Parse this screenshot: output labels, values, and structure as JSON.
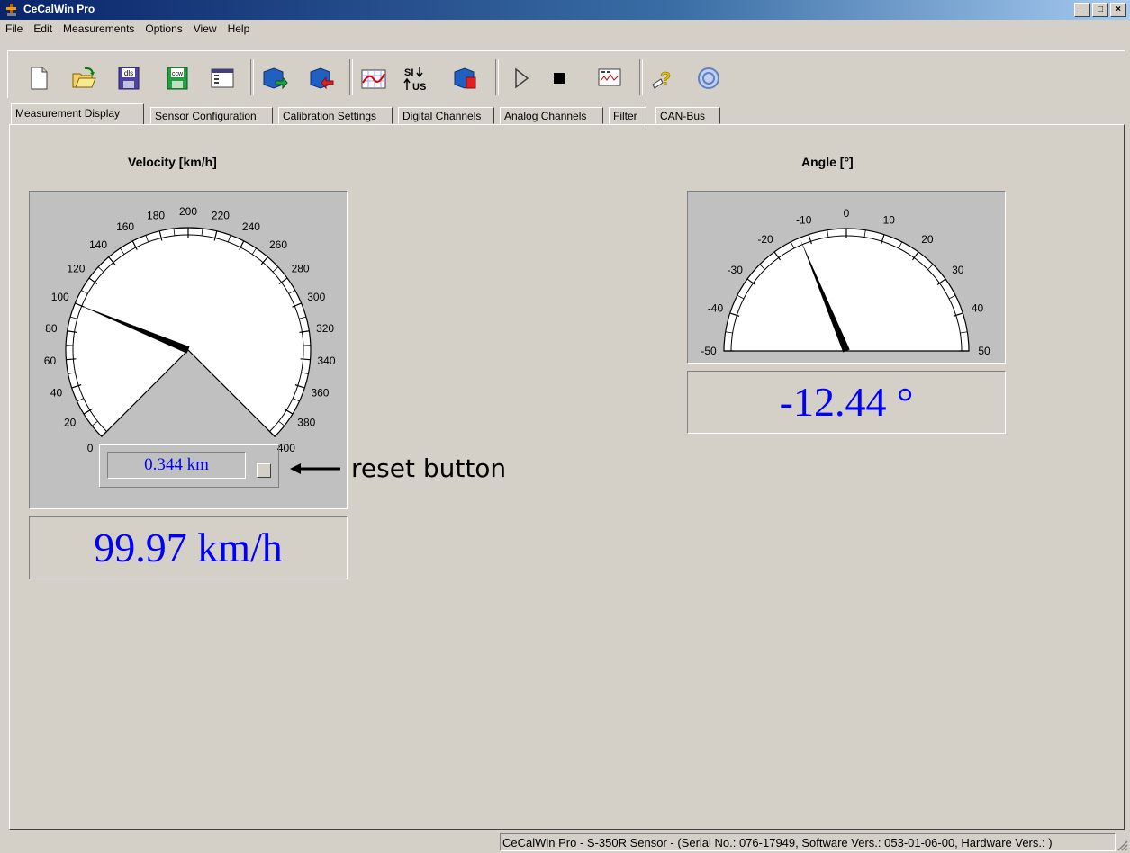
{
  "window": {
    "title": "CeCalWin Pro",
    "buttons": [
      "_",
      "□",
      "×"
    ]
  },
  "menu": [
    "File",
    "Edit",
    "Measurements",
    "Options",
    "View",
    "Help"
  ],
  "toolbar": {
    "buttons": [
      {
        "name": "new-icon"
      },
      {
        "name": "open-icon"
      },
      {
        "name": "save-dls-icon",
        "label": "dls"
      },
      {
        "name": "save-ccw-icon",
        "label": "ccw"
      },
      {
        "name": "window-icon"
      },
      {
        "name": "upload-sensor-icon"
      },
      {
        "name": "download-sensor-icon"
      },
      {
        "name": "chart-icon"
      },
      {
        "name": "si-us-toggle-icon",
        "label_top": "SI",
        "label_bottom": "US"
      },
      {
        "name": "sensor-settings-icon"
      },
      {
        "name": "play-icon"
      },
      {
        "name": "stop-icon"
      },
      {
        "name": "monitor-icon"
      },
      {
        "name": "help-icon"
      },
      {
        "name": "copyright-icon"
      }
    ]
  },
  "tabs": [
    "Measurement Display",
    "Sensor Configuration",
    "Calibration Settings",
    "Digital Channels",
    "Analog Channels",
    "Filter",
    "CAN-Bus"
  ],
  "active_tab": "Measurement Display",
  "velocity": {
    "title": "Velocity [km/h]",
    "value": 99.97,
    "display": "99.97 km/h",
    "min": 0,
    "max": 400,
    "ticks": [
      "0",
      "20",
      "40",
      "60",
      "80",
      "100",
      "120",
      "140",
      "160",
      "180",
      "200",
      "220",
      "240",
      "260",
      "280",
      "300",
      "320",
      "340",
      "360",
      "380",
      "400"
    ],
    "odometer": "0.344 km"
  },
  "angle": {
    "title": "Angle [°]",
    "value": -12.44,
    "display": "-12.44 °",
    "min": -50,
    "max": 50,
    "ticks": [
      "-50",
      "-40",
      "-30",
      "-20",
      "-10",
      "0",
      "10",
      "20",
      "30",
      "40",
      "50"
    ]
  },
  "annotation": "reset button",
  "status": "CeCalWin Pro - S-350R Sensor - (Serial No.: 076-17949, Software Vers.: 053-01-06-00, Hardware Vers.: )"
}
